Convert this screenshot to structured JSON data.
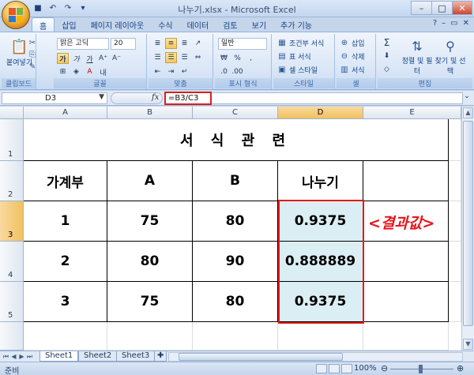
{
  "window": {
    "title": "나누기.xlsx - Microsoft Excel",
    "qat_icons": [
      "save-icon",
      "undo-icon",
      "redo-icon",
      "customize-icon"
    ]
  },
  "ribbon": {
    "tabs": [
      "홈",
      "삽입",
      "페이지 레이아웃",
      "수식",
      "데이터",
      "검토",
      "보기",
      "추가 기능"
    ],
    "active_tab": "홈",
    "clipboard": {
      "paste": "붙여넣기",
      "label": "클립보드"
    },
    "font": {
      "name": "맑은 고딕",
      "size": "20",
      "label": "글꼴",
      "bold": "가",
      "italic": "가",
      "underline": "가"
    },
    "alignment": {
      "label": "맞춤"
    },
    "number": {
      "format": "일반",
      "currency": "₩",
      "percent": "%",
      "comma": ",",
      "label": "표시 형식"
    },
    "styles": {
      "conditional": "조건부 서식",
      "table": "표 서식",
      "cell": "셀 스타일",
      "label": "스타일"
    },
    "cells": {
      "insert": "삽입",
      "delete": "삭제",
      "format": "서식",
      "label": "셀"
    },
    "editing": {
      "sum": "Σ",
      "sort_filter": "정렬 및 필터",
      "find_select": "찾기 및 선택",
      "label": "편집"
    }
  },
  "formula_bar": {
    "name_box": "D3",
    "fx": "fx",
    "formula": "=B3/C3"
  },
  "grid": {
    "columns": [
      "A",
      "B",
      "C",
      "D",
      "E"
    ],
    "rows": [
      "1",
      "2",
      "3",
      "4",
      "5"
    ],
    "selected_column": "D",
    "selected_row": "3",
    "title": "서 식 관 련",
    "headers": [
      "가계부",
      "A",
      "B",
      "나누기"
    ],
    "data": [
      [
        "1",
        "75",
        "80",
        "0.9375"
      ],
      [
        "2",
        "80",
        "90",
        "0.888889"
      ],
      [
        "3",
        "75",
        "80",
        "0.9375"
      ]
    ],
    "annotation": "<결과값>"
  },
  "sheets": {
    "tabs": [
      "Sheet1",
      "Sheet2",
      "Sheet3"
    ],
    "active": "Sheet1"
  },
  "status": {
    "ready": "준비",
    "zoom": "100%"
  },
  "colors": {
    "highlight_red": "#e01a1a",
    "result_fill": "#dbeef3",
    "selected_header": "#f1c15f"
  }
}
